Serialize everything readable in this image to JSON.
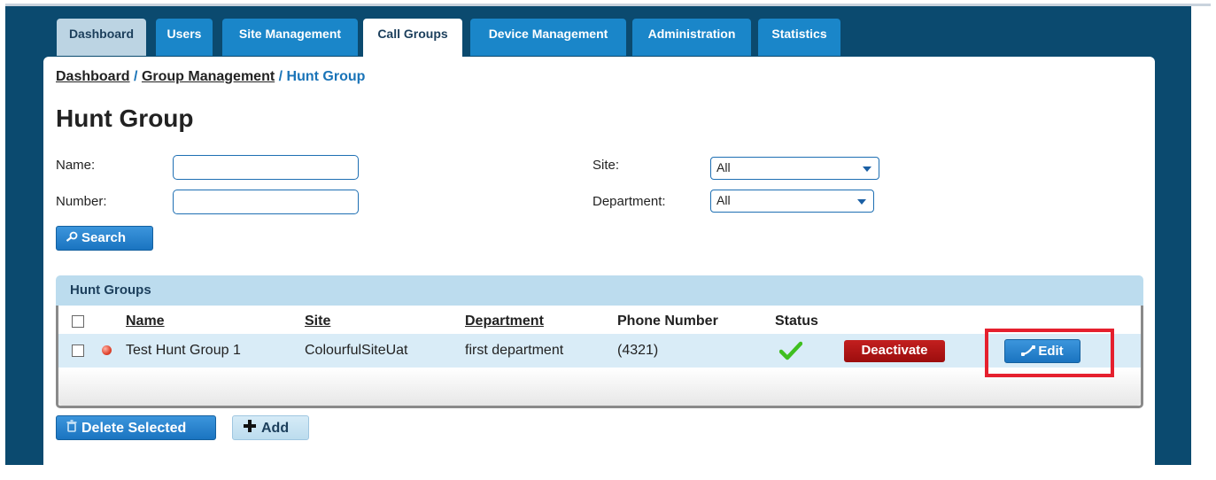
{
  "tabs": [
    {
      "label": "Dashboard"
    },
    {
      "label": "Users"
    },
    {
      "label": "Site Management"
    },
    {
      "label": "Call Groups"
    },
    {
      "label": "Device Management"
    },
    {
      "label": "Administration"
    },
    {
      "label": "Statistics"
    }
  ],
  "active_tab": "Call Groups",
  "breadcrumb": {
    "items": [
      "Dashboard",
      "Group Management",
      "Hunt Group"
    ],
    "separator": "/"
  },
  "page_title": "Hunt Group",
  "filters": {
    "name_label": "Name:",
    "name_value": "",
    "number_label": "Number:",
    "number_value": "",
    "site_label": "Site:",
    "site_value": "All",
    "department_label": "Department:",
    "department_value": "All",
    "search_button": "Search"
  },
  "grid": {
    "title": "Hunt Groups",
    "columns": [
      "Name",
      "Site",
      "Department",
      "Phone Number",
      "Status"
    ],
    "rows": [
      {
        "name": "Test Hunt Group 1",
        "site": "ColourfulSiteUat",
        "department": "first department",
        "phone": "(4321)",
        "status": "active",
        "deactivate_label": "Deactivate",
        "edit_label": "Edit"
      }
    ]
  },
  "actions": {
    "delete_selected": "Delete Selected",
    "add": "Add"
  },
  "colors": {
    "frame": "#0b4a6f",
    "tab_blue": "#1a86c9",
    "grid_header": "#bcdcee",
    "row_bg": "#d9ecf7",
    "deactivate": "#b01515",
    "highlight": "#e5202e"
  },
  "icons": {
    "search": "magnifier-icon",
    "status": "checkmark-icon",
    "edit": "phone-icon",
    "delete": "trash-icon",
    "add": "plus-icon"
  }
}
